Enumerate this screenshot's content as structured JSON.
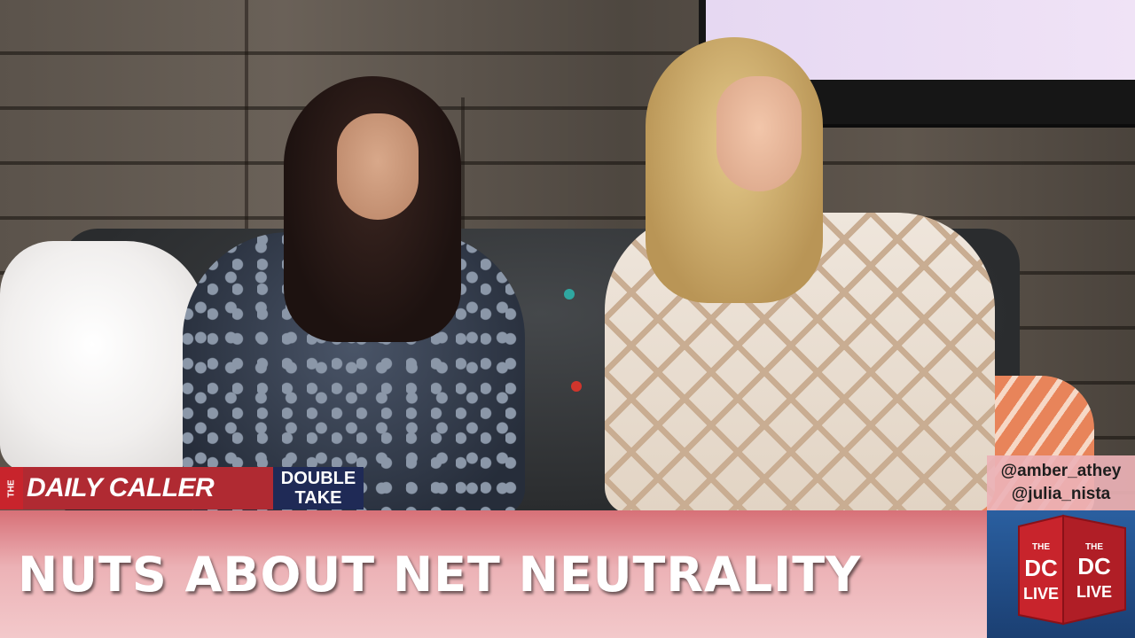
{
  "branding": {
    "logo_prefix": "THE",
    "logo_name": "DAILY CALLER",
    "show_line1": "DOUBLE",
    "show_line2": "TAKE",
    "colors": {
      "logo_red": "#b02a32",
      "logo_navy": "#1f2a56"
    }
  },
  "handles": [
    "@amber_athey",
    "@julia_nista"
  ],
  "lower_third": {
    "headline": "NUTS ABOUT NET NEUTRALITY",
    "color_top": "#d77077",
    "color_bottom": "#f3c9cb"
  },
  "live_badge": {
    "face_left_top": "THE",
    "face_left_mid": "DC",
    "face_left_bot": "LIVE",
    "face_right_top": "THE",
    "face_right_mid": "DC",
    "face_right_bot": "LIVE",
    "color": "#c8242c"
  }
}
